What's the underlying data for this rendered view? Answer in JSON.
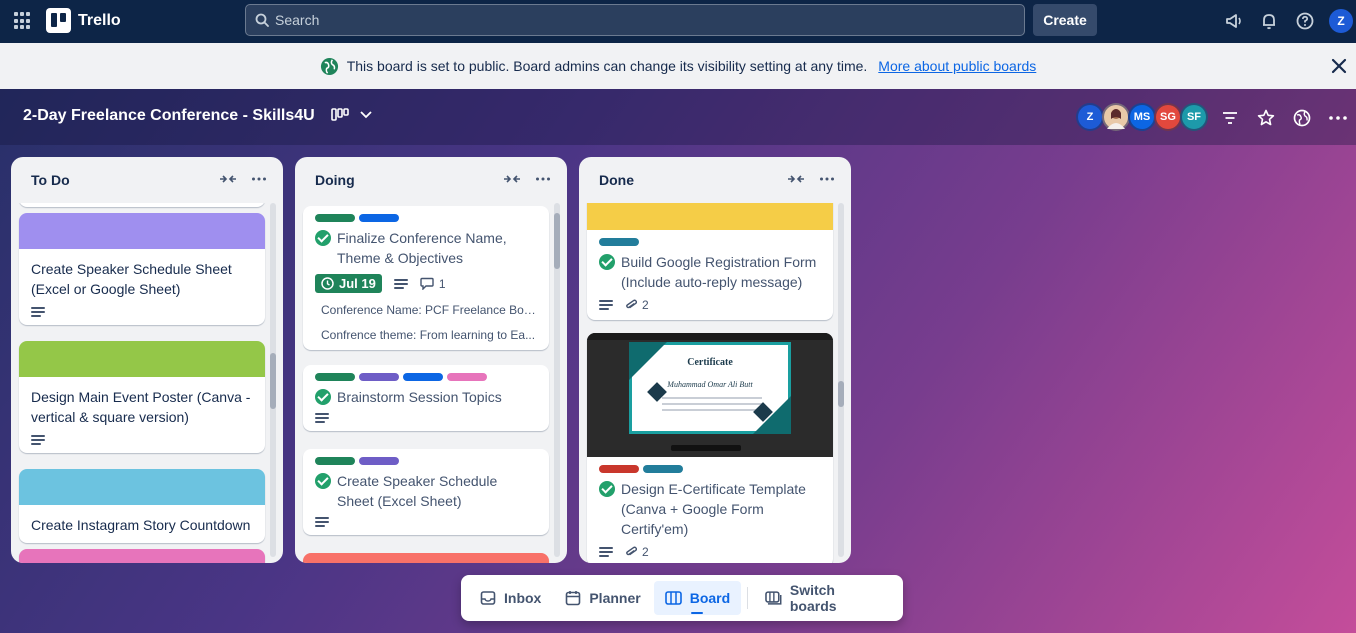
{
  "app": {
    "name": "Trello"
  },
  "topnav": {
    "search_placeholder": "Search",
    "create_label": "Create",
    "user_initial": "Z"
  },
  "banner": {
    "message": "This board is set to public. Board admins can change its visibility setting at any time.",
    "link_text": "More about public boards"
  },
  "board": {
    "title": "2-Day Freelance Conference - Skills4U",
    "members": [
      {
        "initials": "Z",
        "color": "#1d5bd6"
      },
      {
        "initials": "",
        "color": "#e8c9a8"
      },
      {
        "initials": "MS",
        "color": "#0c66e4"
      },
      {
        "initials": "SG",
        "color": "#e2483d"
      },
      {
        "initials": "SF",
        "color": "#1d9aaa"
      }
    ]
  },
  "lists": [
    {
      "name": "To Do",
      "cards": [
        {
          "title": "Create Speaker Schedule Sheet (Excel or Google Sheet)",
          "cover": "#9f8fef"
        },
        {
          "title": "Design Main Event Poster (Canva - vertical & square version)",
          "cover": "#94c748"
        },
        {
          "title": "Create Instagram Story Countdown",
          "cover": "#6cc3e0"
        }
      ]
    },
    {
      "name": "Doing",
      "cards": [
        {
          "title": "Finalize Conference Name, Theme & Objectives",
          "labels": [
            "#1f845a",
            "#0c66e4"
          ],
          "due": "Jul 19",
          "comments": "1",
          "fields": [
            "Conference Name: PCF Freelance Boo...",
            "Confrence theme: From learning to Ea..."
          ]
        },
        {
          "title": "Brainstorm Session Topics",
          "labels": [
            "#1f845a",
            "#6e5dc6",
            "#0c66e4",
            "#e774bb"
          ]
        },
        {
          "title": "Create Speaker Schedule Sheet (Excel Sheet)",
          "labels": [
            "#1f845a",
            "#6e5dc6"
          ]
        }
      ]
    },
    {
      "name": "Done",
      "cards": [
        {
          "title": "Build Google Registration Form (Include auto-reply message)",
          "cover": "#f5cd47",
          "labels": [
            "#227d9b"
          ],
          "attachments": "2"
        },
        {
          "title": "Design E-Certificate Template (Canva + Google Form Certify'em)",
          "labels": [
            "#c9372c",
            "#227d9b"
          ],
          "attachments": "2",
          "certificate": {
            "heading": "Certificate",
            "name": "Muhammad Omar Ali Butt"
          }
        }
      ]
    }
  ],
  "bottombar": {
    "inbox": "Inbox",
    "planner": "Planner",
    "board": "Board",
    "switch": "Switch boards"
  }
}
